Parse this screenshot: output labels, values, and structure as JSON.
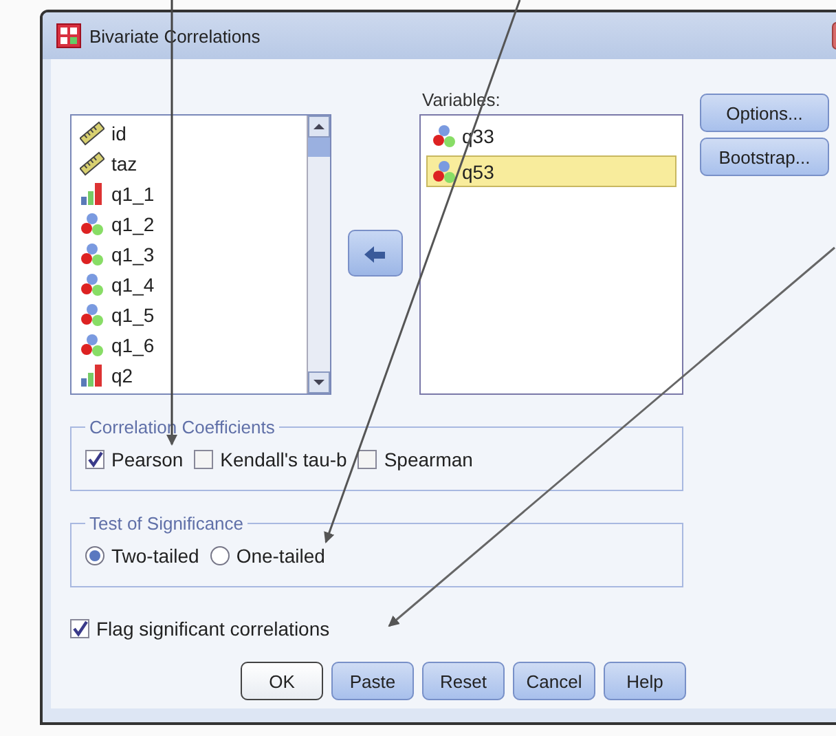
{
  "window": {
    "title": "Bivariate Correlations"
  },
  "source_list": {
    "items": [
      {
        "name": "id",
        "kind": "scale"
      },
      {
        "name": "taz",
        "kind": "scale"
      },
      {
        "name": "q1_1",
        "kind": "ordinal"
      },
      {
        "name": "q1_2",
        "kind": "nominal"
      },
      {
        "name": "q1_3",
        "kind": "nominal"
      },
      {
        "name": "q1_4",
        "kind": "nominal"
      },
      {
        "name": "q1_5",
        "kind": "nominal"
      },
      {
        "name": "q1_6",
        "kind": "nominal"
      },
      {
        "name": "q2",
        "kind": "ordinal"
      }
    ]
  },
  "variables": {
    "label": "Variables:",
    "items": [
      {
        "name": "q33",
        "kind": "nominal",
        "selected": false
      },
      {
        "name": "q53",
        "kind": "nominal",
        "selected": true
      }
    ]
  },
  "side_buttons": [
    "Options...",
    "Bootstrap..."
  ],
  "correlation_coefficients": {
    "title": "Correlation Coefficients",
    "options": [
      {
        "label": "Pearson",
        "checked": true
      },
      {
        "label": "Kendall's tau-b",
        "checked": false
      },
      {
        "label": "Spearman",
        "checked": false
      }
    ]
  },
  "test_of_significance": {
    "title": "Test of Significance",
    "options": [
      {
        "label": "Two-tailed",
        "selected": true
      },
      {
        "label": "One-tailed",
        "selected": false
      }
    ]
  },
  "flag": {
    "label": "Flag significant correlations",
    "checked": true
  },
  "buttons": [
    {
      "label": "OK",
      "default": true
    },
    {
      "label": "Paste",
      "default": false
    },
    {
      "label": "Reset",
      "default": false
    },
    {
      "label": "Cancel",
      "default": false
    },
    {
      "label": "Help",
      "default": false
    }
  ]
}
